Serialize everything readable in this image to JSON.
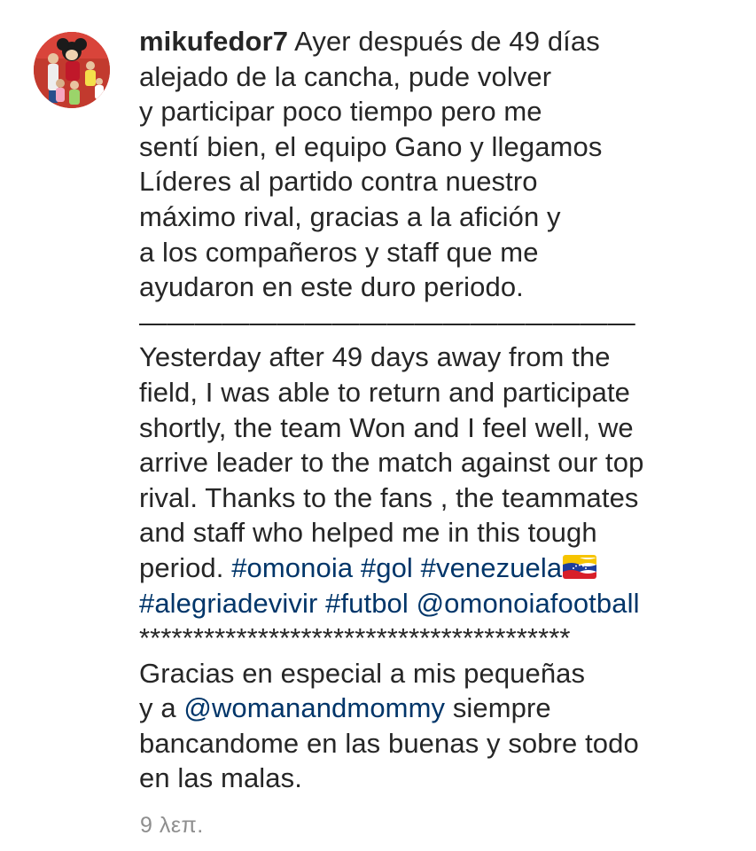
{
  "comment": {
    "avatar_icon": "profile-photo-avatar",
    "username": "mikufedor7",
    "spanish": [
      "Ayer después de 49 días",
      "alejado de la cancha, pude volver",
      "y participar poco tiempo pero me",
      "sentí bien, el equipo Gano y llegamos",
      "Líderes al partido contra nuestro",
      "máximo rival, gracias a la afición y",
      "a los compañeros y staff que me",
      "ayudaron en este duro periodo."
    ],
    "divider": "——————————————————",
    "english": [
      "Yesterday after 49 days away from the",
      "field, I was able to return and participate",
      "shortly, the team Won and I feel well, we",
      "arrive leader to the match against our top",
      "rival. Thanks to the fans , the teammates",
      "and staff who helped me in this tough"
    ],
    "english_last_text": "period. ",
    "tags_line1": [
      "#omonoia",
      "#gol",
      "#venezuela"
    ],
    "flag_icon": "venezuela-flag-icon",
    "tags_line2": [
      "#alegriadevivir",
      "#futbol",
      "@omonoiafootball"
    ],
    "stars": "****************************************",
    "thanks_line1": "Gracias en especial a mis pequeñas",
    "thanks_line2_prefix": "y a ",
    "thanks_mention": "@womanandmommy",
    "thanks_line2_suffix": " siempre",
    "thanks_line3": "bancandome en las buenas y sobre todo",
    "thanks_line4": "en las malas.",
    "timestamp": "9 λεπ."
  },
  "colors": {
    "text": "#262626",
    "link": "#003569",
    "muted": "#8e8e8e",
    "background": "#ffffff"
  }
}
